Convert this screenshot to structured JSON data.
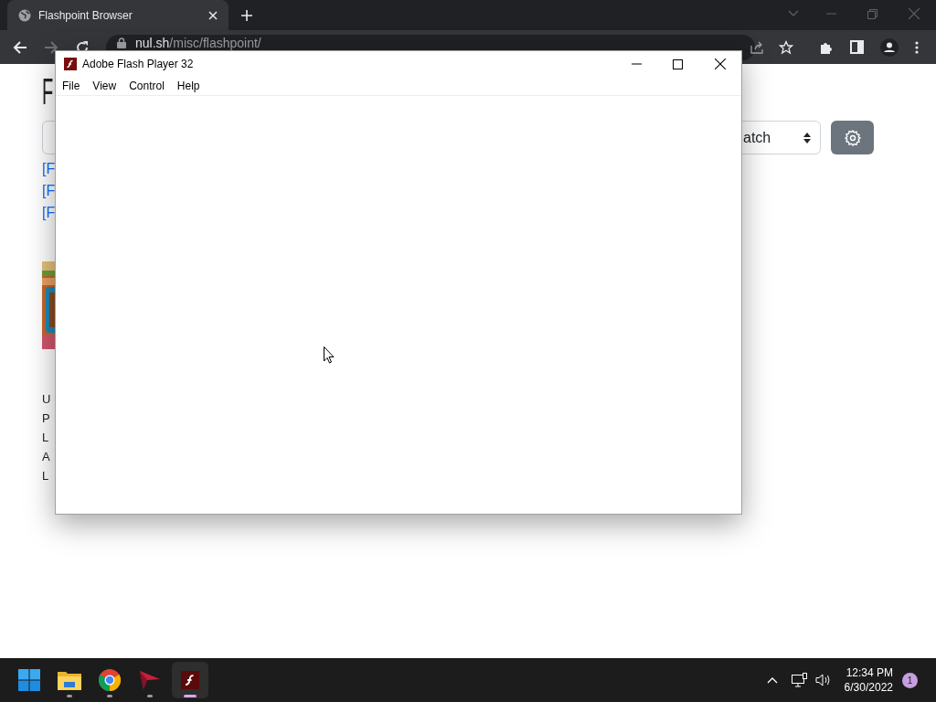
{
  "browser": {
    "tab": {
      "title": "Flashpoint Browser"
    },
    "address": "**nul.sh**/misc/flashpoint/"
  },
  "page": {
    "heading": "F",
    "select_value": "atch",
    "links": [
      "[F",
      "[F",
      "[F"
    ],
    "details": [
      "U",
      "P",
      "L",
      "A",
      "L"
    ]
  },
  "flash_window": {
    "title": "Adobe Flash Player 32",
    "menu": [
      "File",
      "View",
      "Control",
      "Help"
    ]
  },
  "taskbar": {
    "apps": [
      {
        "kind": "start",
        "running": false,
        "selected": false
      },
      {
        "kind": "folder",
        "running": true,
        "selected": false
      },
      {
        "kind": "chrome",
        "running": true,
        "selected": false
      },
      {
        "kind": "arrow",
        "running": true,
        "selected": false
      },
      {
        "kind": "flash",
        "running": true,
        "selected": true
      }
    ],
    "time": "12:34 PM",
    "date": "6/30/2022",
    "notifications": "1"
  }
}
